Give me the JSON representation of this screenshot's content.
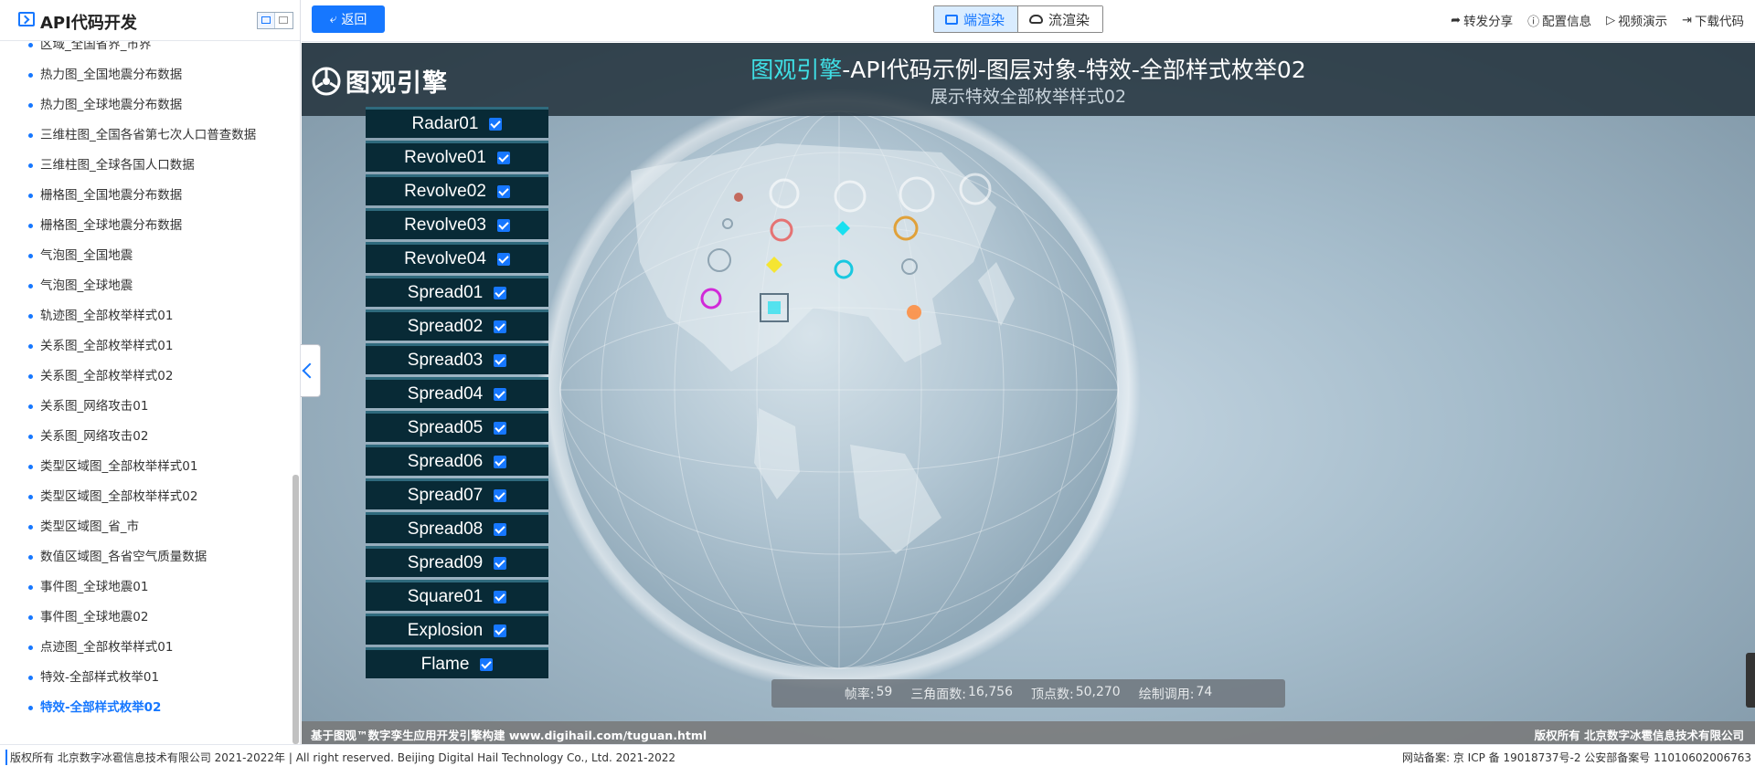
{
  "sidebar": {
    "title": "API代码开发",
    "items": [
      {
        "label": "区域_全国省界_市界",
        "active": false
      },
      {
        "label": "热力图_全国地震分布数据",
        "active": false
      },
      {
        "label": "热力图_全球地震分布数据",
        "active": false
      },
      {
        "label": "三维柱图_全国各省第七次人口普查数据",
        "active": false
      },
      {
        "label": "三维柱图_全球各国人口数据",
        "active": false
      },
      {
        "label": "栅格图_全国地震分布数据",
        "active": false
      },
      {
        "label": "栅格图_全球地震分布数据",
        "active": false
      },
      {
        "label": "气泡图_全国地震",
        "active": false
      },
      {
        "label": "气泡图_全球地震",
        "active": false
      },
      {
        "label": "轨迹图_全部枚举样式01",
        "active": false
      },
      {
        "label": "关系图_全部枚举样式01",
        "active": false
      },
      {
        "label": "关系图_全部枚举样式02",
        "active": false
      },
      {
        "label": "关系图_网络攻击01",
        "active": false
      },
      {
        "label": "关系图_网络攻击02",
        "active": false
      },
      {
        "label": "类型区域图_全部枚举样式01",
        "active": false
      },
      {
        "label": "类型区域图_全部枚举样式02",
        "active": false
      },
      {
        "label": "类型区域图_省_市",
        "active": false
      },
      {
        "label": "数值区域图_各省空气质量数据",
        "active": false
      },
      {
        "label": "事件图_全球地震01",
        "active": false
      },
      {
        "label": "事件图_全球地震02",
        "active": false
      },
      {
        "label": "点迹图_全部枚举样式01",
        "active": false
      },
      {
        "label": "特效-全部样式枚举01",
        "active": false
      },
      {
        "label": "特效-全部样式枚举02",
        "active": true
      }
    ]
  },
  "toolbar": {
    "back_label": "返回",
    "render_local": "端渲染",
    "render_stream": "流渲染",
    "actions": [
      {
        "label": "转发分享",
        "icon": "share-icon"
      },
      {
        "label": "配置信息",
        "icon": "info-icon"
      },
      {
        "label": "视频演示",
        "icon": "play-icon"
      },
      {
        "label": "下载代码",
        "icon": "download-icon"
      }
    ]
  },
  "viewport": {
    "logo_text": "图观引擎",
    "title_highlight": "图观引擎",
    "title_rest": "-API代码示例-图层对象-特效-全部样式枚举02",
    "subtitle": "展示特效全部枚举样式02",
    "layers": [
      {
        "label": "Radar01",
        "checked": true
      },
      {
        "label": "Revolve01",
        "checked": true
      },
      {
        "label": "Revolve02",
        "checked": true
      },
      {
        "label": "Revolve03",
        "checked": true
      },
      {
        "label": "Revolve04",
        "checked": true
      },
      {
        "label": "Spread01",
        "checked": true
      },
      {
        "label": "Spread02",
        "checked": true
      },
      {
        "label": "Spread03",
        "checked": true
      },
      {
        "label": "Spread04",
        "checked": true
      },
      {
        "label": "Spread05",
        "checked": true
      },
      {
        "label": "Spread06",
        "checked": true
      },
      {
        "label": "Spread07",
        "checked": true
      },
      {
        "label": "Spread08",
        "checked": true
      },
      {
        "label": "Spread09",
        "checked": true
      },
      {
        "label": "Square01",
        "checked": true
      },
      {
        "label": "Explosion",
        "checked": true
      },
      {
        "label": "Flame",
        "checked": true
      }
    ],
    "stats": {
      "fps_label": "帧率:",
      "fps": "59",
      "triangles_label": "三角面数:",
      "triangles": "16,756",
      "vertices_label": "顶点数:",
      "vertices": "50,270",
      "drawcalls_label": "绘制调用:",
      "drawcalls": "74"
    },
    "footer_left": "基于图观™数字孪生应用开发引擎构建 www.digihail.com/tuguan.html",
    "footer_right": "版权所有 北京数字冰雹信息技术有限公司"
  },
  "bottom": {
    "left": "版权所有 北京数字冰雹信息技术有限公司 2021-2022年 | All right reserved. Beijing Digital Hail Technology Co., Ltd. 2021-2022",
    "right": "网站备案: 京 ICP 备 19018737号-2 公安部备案号 11010602006763"
  },
  "colors": {
    "accent": "#1677ff",
    "title_highlight": "#3fe0e6",
    "layer_bg": "#082a36"
  }
}
